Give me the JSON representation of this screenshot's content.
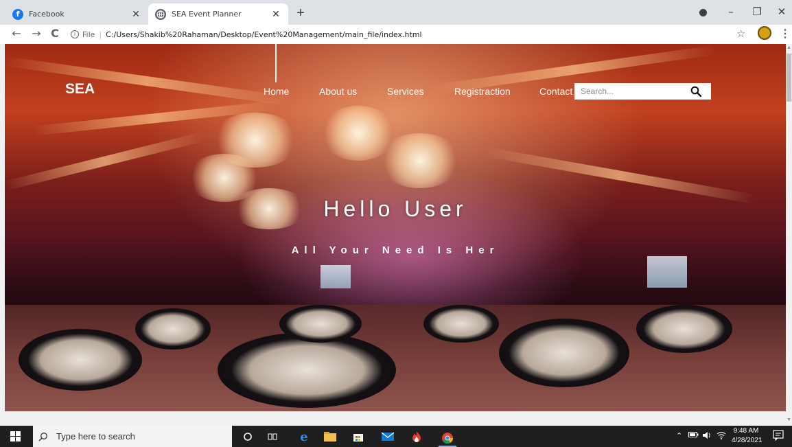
{
  "browser": {
    "tabs": [
      {
        "title": "Facebook",
        "favicon": "facebook-icon",
        "active": false
      },
      {
        "title": "SEA Event Planner",
        "favicon": "globe-icon",
        "active": true
      }
    ],
    "new_tab_label": "+",
    "controls": {
      "minimize": "–",
      "maximize": "❐",
      "close": "✕"
    },
    "nav": {
      "back": "←",
      "forward": "→",
      "reload": "C"
    },
    "address": {
      "scheme_label": "File",
      "url": "C:/Users/Shakib%20Rahaman/Desktop/Event%20Management/main_file/index.html"
    },
    "star": "☆",
    "menu": "⋮"
  },
  "site": {
    "brand": "SEA",
    "nav": [
      "Home",
      "About us",
      "Services",
      "Registraction",
      "Contact"
    ],
    "search": {
      "placeholder": "Search..."
    },
    "hero": {
      "title": "Hello User",
      "subtitle": "All Your Need Is Her"
    }
  },
  "taskbar": {
    "search_placeholder": "Type here to search",
    "time": "9:48 AM",
    "date": "4/28/2021"
  }
}
